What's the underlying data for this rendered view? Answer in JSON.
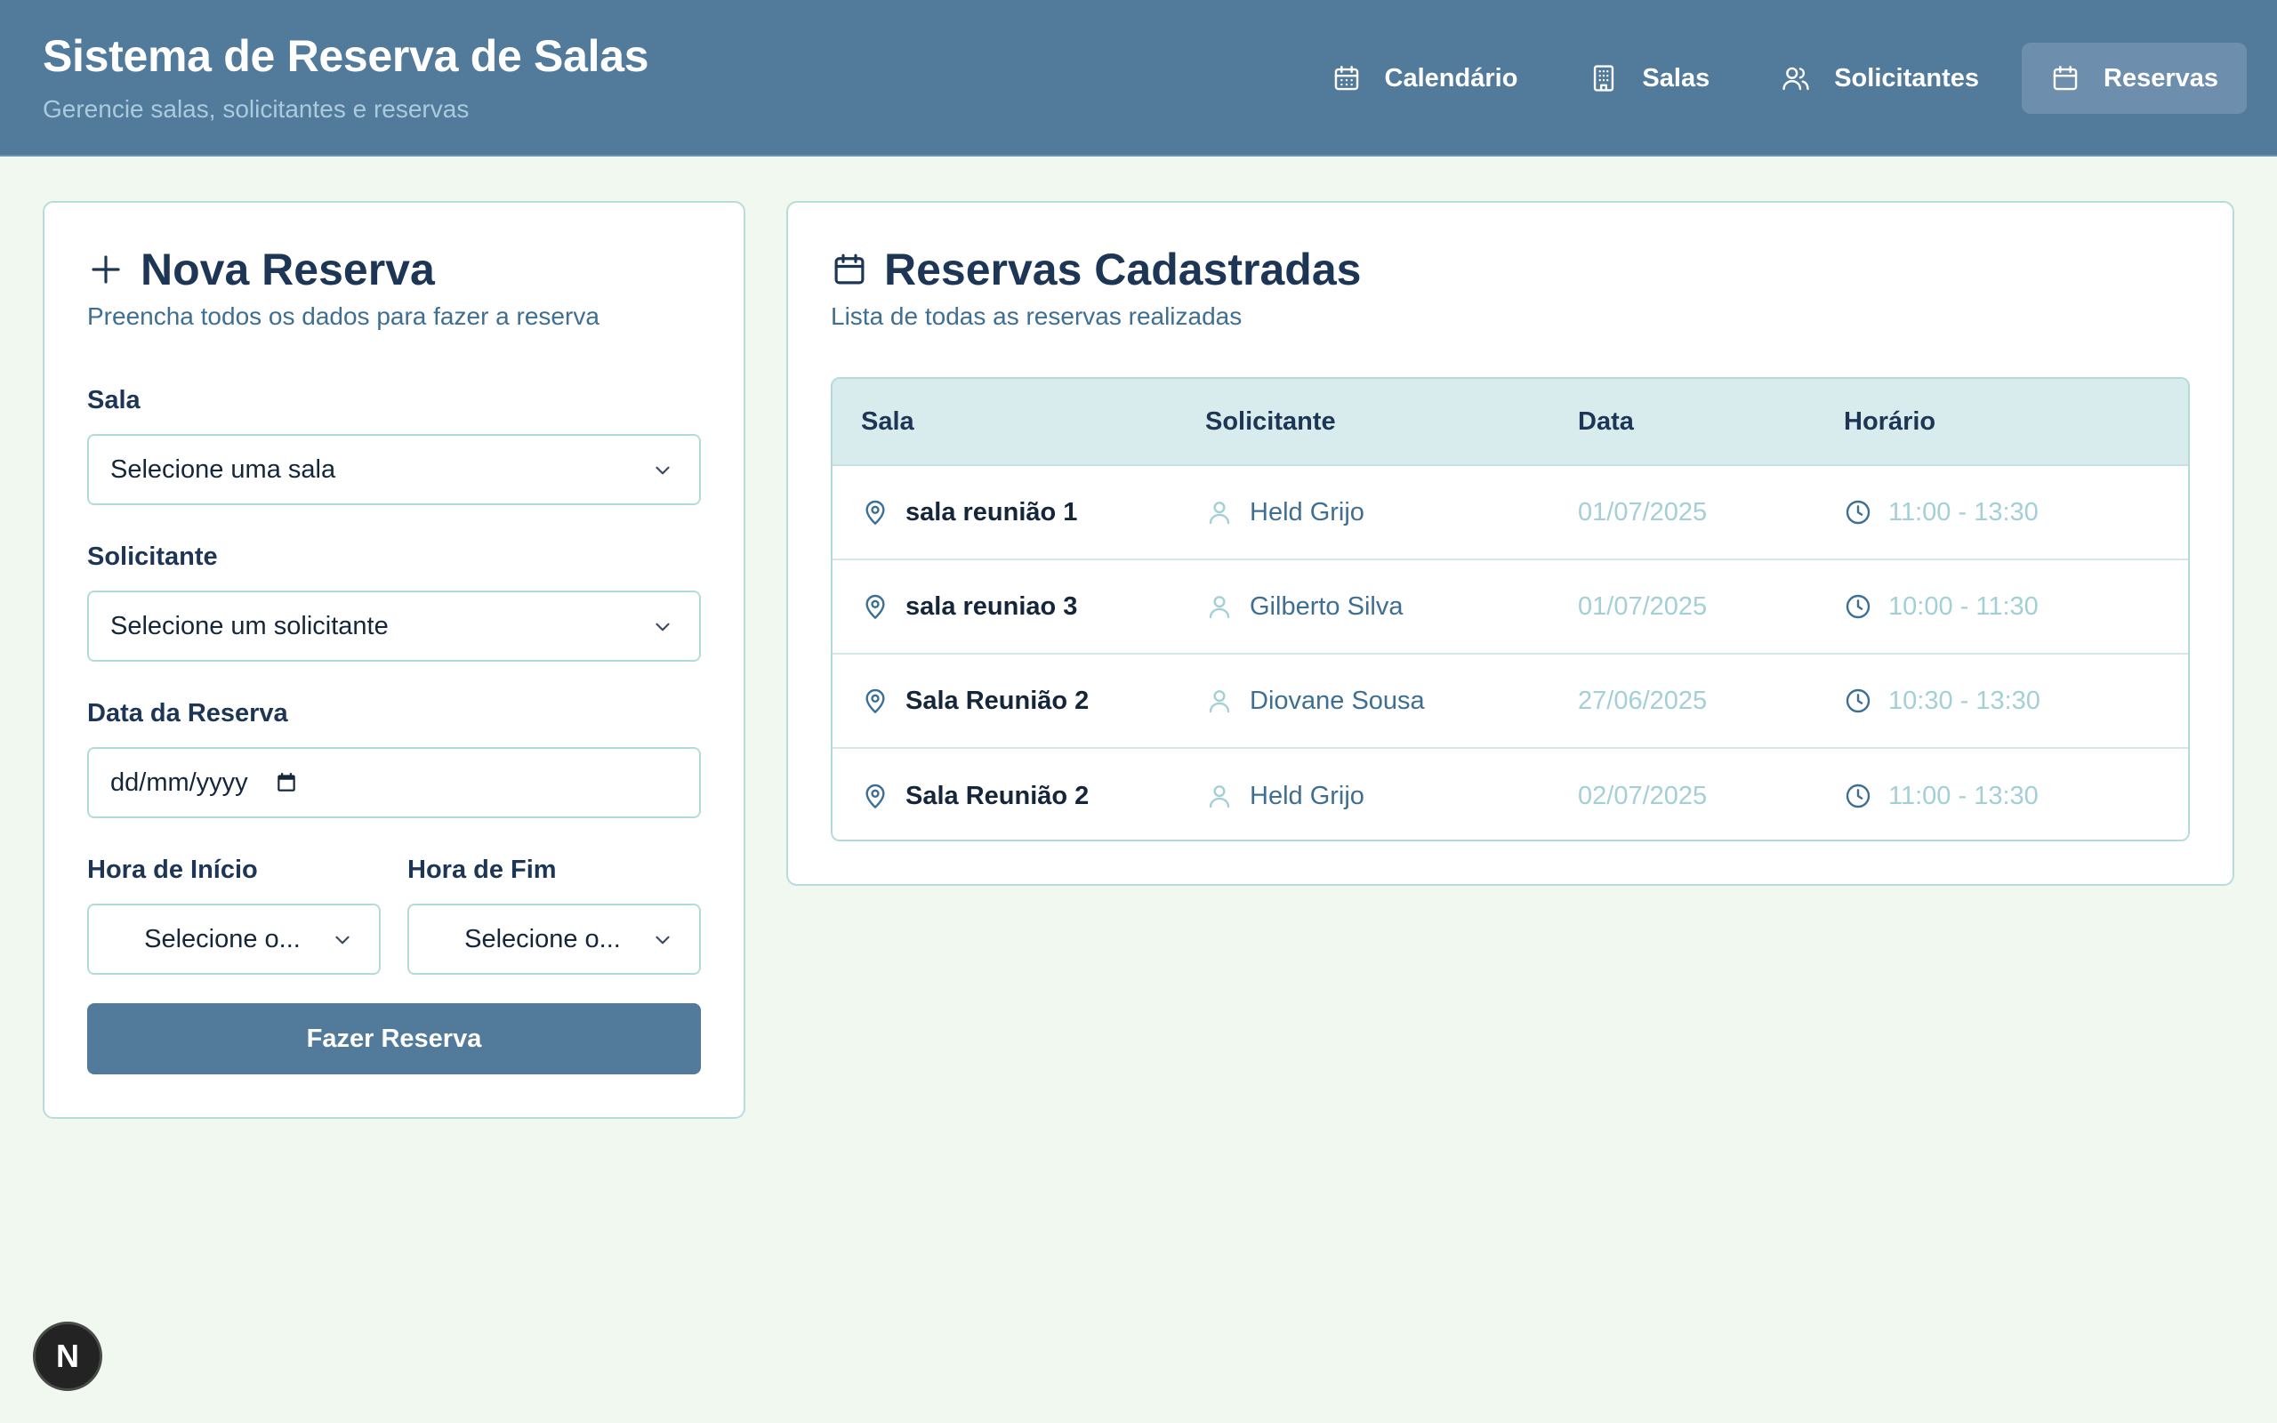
{
  "header": {
    "title": "Sistema de Reserva de Salas",
    "subtitle": "Gerencie salas, solicitantes e reservas",
    "nav": [
      {
        "label": "Calendário",
        "icon": "calendar-icon"
      },
      {
        "label": "Salas",
        "icon": "building-icon"
      },
      {
        "label": "Solicitantes",
        "icon": "users-icon"
      },
      {
        "label": "Reservas",
        "icon": "calendar-icon",
        "active": true
      }
    ]
  },
  "form": {
    "title": "Nova Reserva",
    "subtitle": "Preencha todos os dados para fazer a reserva",
    "sala_label": "Sala",
    "sala_placeholder": "Selecione uma sala",
    "solicitante_label": "Solicitante",
    "solicitante_placeholder": "Selecione um solicitante",
    "data_label": "Data da Reserva",
    "data_placeholder": "dd/mm/yyyy",
    "inicio_label": "Hora de Início",
    "inicio_placeholder": "Selecione o...",
    "fim_label": "Hora de Fim",
    "fim_placeholder": "Selecione o...",
    "submit_label": "Fazer Reserva"
  },
  "list": {
    "title": "Reservas Cadastradas",
    "subtitle": "Lista de todas as reservas realizadas",
    "columns": [
      "Sala",
      "Solicitante",
      "Data",
      "Horário"
    ],
    "rows": [
      {
        "sala": "sala reunião 1",
        "solicitante": "Held Grijo",
        "data": "01/07/2025",
        "horario": "11:00 - 13:30"
      },
      {
        "sala": "sala reuniao 3",
        "solicitante": "Gilberto Silva",
        "data": "01/07/2025",
        "horario": "10:00 - 11:30"
      },
      {
        "sala": "Sala Reunião 2",
        "solicitante": "Diovane Sousa",
        "data": "27/06/2025",
        "horario": "10:30 - 13:30"
      },
      {
        "sala": "Sala Reunião 2",
        "solicitante": "Held Grijo",
        "data": "02/07/2025",
        "horario": "11:00 - 13:30"
      }
    ]
  },
  "badge": {
    "label": "N"
  },
  "colors": {
    "header_bg": "#527a9b",
    "page_bg": "#f1f8ef",
    "accent": "#527a9b",
    "muted_text": "#a3cfd6"
  }
}
